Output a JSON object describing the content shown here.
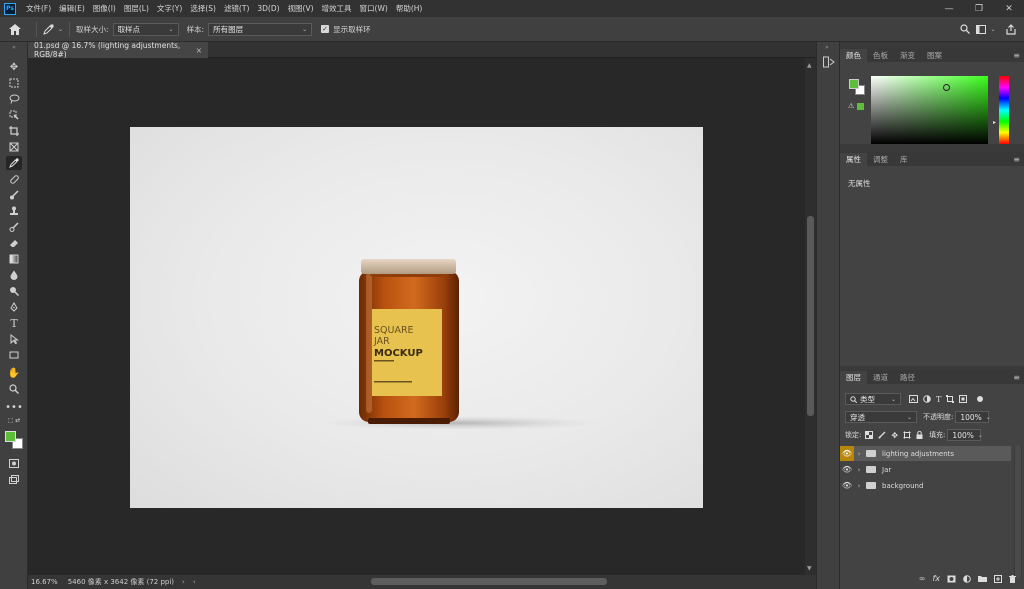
{
  "app": {
    "logo": "Ps",
    "menu": [
      "文件(F)",
      "编辑(E)",
      "图像(I)",
      "图层(L)",
      "文字(Y)",
      "选择(S)",
      "滤镜(T)",
      "3D(D)",
      "视图(V)",
      "增效工具",
      "窗口(W)",
      "帮助(H)"
    ]
  },
  "options": {
    "sample_size_label": "取样大小:",
    "sample_size_value": "取样点",
    "sample_label": "样本:",
    "sample_value": "所有图层",
    "show_ring_label": "显示取样环"
  },
  "document": {
    "tab_title": "01.psd @ 16.7% (lighting adjustments, RGB/8#)",
    "close": "×",
    "jar_label_line1": "SQUARE",
    "jar_label_line2": "JAR",
    "jar_label_line3": "MOCKUP"
  },
  "status": {
    "zoom": "16.67%",
    "doc_info": "5460 像素 x 3642 像素 (72 ppi)"
  },
  "color_panel": {
    "tabs": [
      "颜色",
      "色板",
      "渐变",
      "图案"
    ],
    "foreground": "#5fbd3c",
    "background": "#ffffff",
    "hue": "#3cff1e"
  },
  "properties_panel": {
    "tabs": [
      "属性",
      "调整",
      "库"
    ],
    "content": "无属性"
  },
  "layers_panel": {
    "tabs": [
      "图层",
      "通道",
      "路径"
    ],
    "filter_label": "类型",
    "blend_mode": "穿透",
    "opacity_label": "不透明度:",
    "opacity_value": "100%",
    "lock_label": "锁定:",
    "fill_label": "填充:",
    "fill_value": "100%",
    "layers": [
      {
        "name": "lighting adjustments",
        "selected": true
      },
      {
        "name": "Jar",
        "selected": false
      },
      {
        "name": "background",
        "selected": false
      }
    ],
    "footer_icons": [
      "link-icon",
      "fx-icon",
      "mask-icon",
      "adjustment-icon",
      "folder-icon",
      "new-layer-icon",
      "trash-icon"
    ]
  }
}
